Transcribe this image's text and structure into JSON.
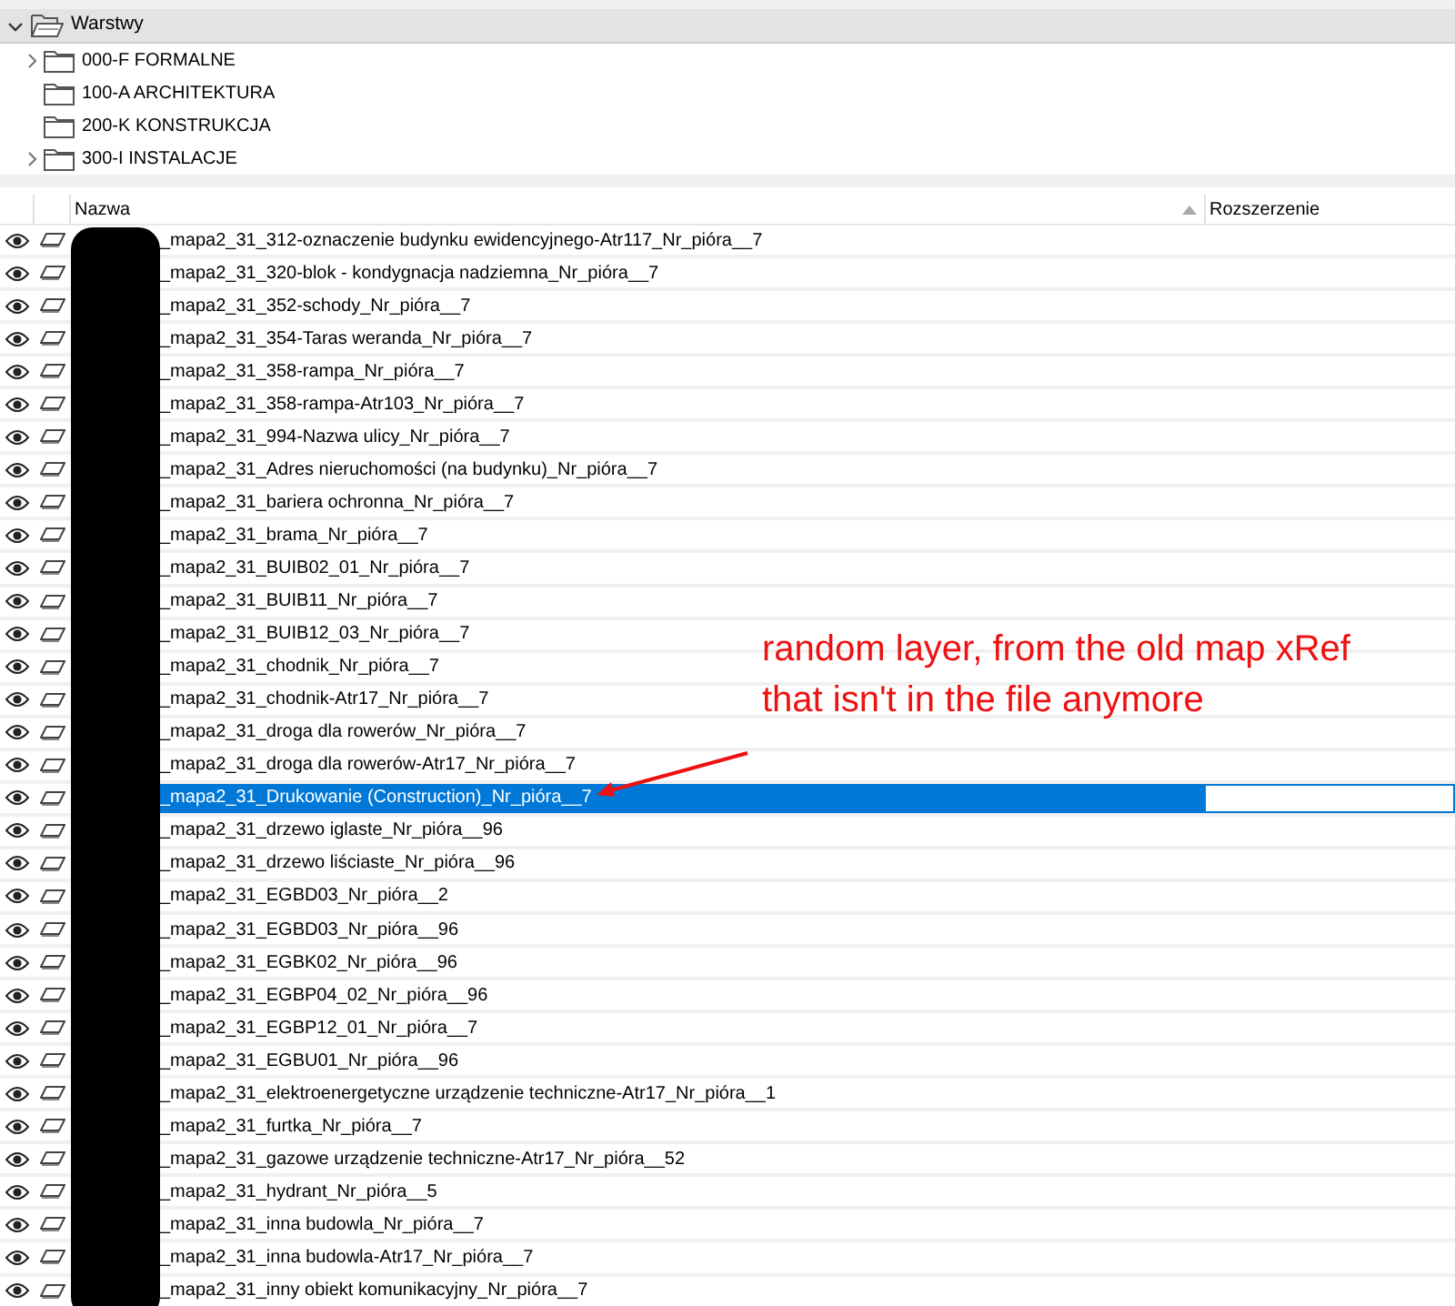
{
  "panel": {
    "title": "Warstwy",
    "expanded": true
  },
  "folders": [
    {
      "label": "000-F FORMALNE",
      "has_children": true
    },
    {
      "label": "100-A ARCHITEKTURA",
      "has_children": false
    },
    {
      "label": "200-K KONSTRUKCJA",
      "has_children": false
    },
    {
      "label": "300-I INSTALACJE",
      "has_children": true
    }
  ],
  "table": {
    "columns": [
      "Nazwa",
      "Rozszerzenie"
    ],
    "rows": [
      {
        "name": "_mapa2_31_312-oznaczenie budynku ewidencyjnego-Atr117_Nr_pióra__7",
        "selected": false
      },
      {
        "name": "_mapa2_31_320-blok - kondygnacja nadziemna_Nr_pióra__7",
        "selected": false
      },
      {
        "name": "_mapa2_31_352-schody_Nr_pióra__7",
        "selected": false
      },
      {
        "name": "_mapa2_31_354-Taras weranda_Nr_pióra__7",
        "selected": false
      },
      {
        "name": "_mapa2_31_358-rampa_Nr_pióra__7",
        "selected": false
      },
      {
        "name": "_mapa2_31_358-rampa-Atr103_Nr_pióra__7",
        "selected": false
      },
      {
        "name": "_mapa2_31_994-Nazwa ulicy_Nr_pióra__7",
        "selected": false
      },
      {
        "name": "_mapa2_31_Adres nieruchomości (na budynku)_Nr_pióra__7",
        "selected": false
      },
      {
        "name": "_mapa2_31_bariera ochronna_Nr_pióra__7",
        "selected": false
      },
      {
        "name": "_mapa2_31_brama_Nr_pióra__7",
        "selected": false
      },
      {
        "name": "_mapa2_31_BUIB02_01_Nr_pióra__7",
        "selected": false
      },
      {
        "name": "_mapa2_31_BUIB11_Nr_pióra__7",
        "selected": false
      },
      {
        "name": "_mapa2_31_BUIB12_03_Nr_pióra__7",
        "selected": false
      },
      {
        "name": "_mapa2_31_chodnik_Nr_pióra__7",
        "selected": false
      },
      {
        "name": "_mapa2_31_chodnik-Atr17_Nr_pióra__7",
        "selected": false
      },
      {
        "name": "_mapa2_31_droga dla rowerów_Nr_pióra__7",
        "selected": false
      },
      {
        "name": "_mapa2_31_droga dla rowerów-Atr17_Nr_pióra__7",
        "selected": false
      },
      {
        "name": "_mapa2_31_Drukowanie (Construction)_Nr_pióra__7",
        "selected": true
      },
      {
        "name": "_mapa2_31_drzewo iglaste_Nr_pióra__96",
        "selected": false
      },
      {
        "name": "_mapa2_31_drzewo liściaste_Nr_pióra__96",
        "selected": false
      },
      {
        "name": "_mapa2_31_EGBD03_Nr_pióra__2",
        "selected": false
      },
      {
        "name": "_mapa2_31_EGBD03_Nr_pióra__96",
        "selected": false
      },
      {
        "name": "_mapa2_31_EGBK02_Nr_pióra__96",
        "selected": false
      },
      {
        "name": "_mapa2_31_EGBP04_02_Nr_pióra__96",
        "selected": false
      },
      {
        "name": "_mapa2_31_EGBP12_01_Nr_pióra__7",
        "selected": false
      },
      {
        "name": "_mapa2_31_EGBU01_Nr_pióra__96",
        "selected": false
      },
      {
        "name": "_mapa2_31_elektroenergetyczne urządzenie techniczne-Atr17_Nr_pióra__1",
        "selected": false
      },
      {
        "name": "_mapa2_31_furtka_Nr_pióra__7",
        "selected": false
      },
      {
        "name": "_mapa2_31_gazowe urządzenie techniczne-Atr17_Nr_pióra__52",
        "selected": false
      },
      {
        "name": "_mapa2_31_hydrant_Nr_pióra__5",
        "selected": false
      },
      {
        "name": "_mapa2_31_inna budowla_Nr_pióra__7",
        "selected": false
      },
      {
        "name": "_mapa2_31_inna budowla-Atr17_Nr_pióra__7",
        "selected": false
      },
      {
        "name": "_mapa2_31_inny obiekt komunikacyjny_Nr_pióra__7",
        "selected": false
      }
    ]
  },
  "annotation": {
    "lines": [
      "random layer, from the old map xRef",
      "that isn't in the file anymore"
    ]
  }
}
